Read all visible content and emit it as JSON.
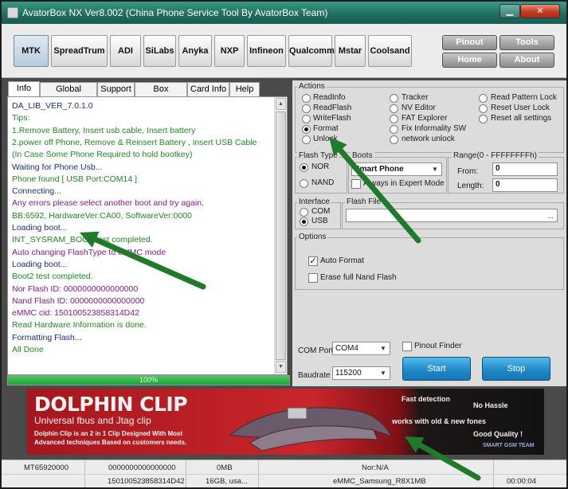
{
  "window": {
    "title": "AvatorBox NX Ver8.002 (China Phone Service Tool By AvatorBox Team)",
    "minimize_glyph": "▁",
    "close_glyph": "✕"
  },
  "platforms": [
    "MTK",
    "SpreadTrum",
    "ADI",
    "SiLabs",
    "Anyka",
    "NXP",
    "Infineon",
    "Qualcomm",
    "Mstar",
    "Coolsand"
  ],
  "nav": {
    "pinout": "Pinout",
    "tools": "Tools",
    "home": "Home",
    "about": "About"
  },
  "tabs": [
    "Info",
    "Global Settings",
    "Support",
    "Box Manager",
    "Card Info",
    "Help"
  ],
  "log": [
    {
      "text": "DA_LIB_VER_7.0.1.0",
      "color": "navy"
    },
    {
      "text": "Tips:",
      "color": "green"
    },
    {
      "text": "1.Remove Battery, Insert usb cable, Insert battery",
      "color": "green"
    },
    {
      "text": "2.power off Phone, Remove & Reinsert Battery , insert USB Cable",
      "color": "green"
    },
    {
      "text": "(In Case Some Phone Required to hold bootkey)",
      "color": "green"
    },
    {
      "text": "Waiting for Phone Usb...",
      "color": "navy"
    },
    {
      "text": "Phone found [ USB Port:COM14 ]",
      "color": "green"
    },
    {
      "text": "Connecting...",
      "color": "navy"
    },
    {
      "text": "Any errors please select another boot and try again.",
      "color": "purple"
    },
    {
      "text": "BB:6592,    HardwareVer:CA00,    SoftwareVer:0000",
      "color": "green"
    },
    {
      "text": "Loading boot...",
      "color": "navy"
    },
    {
      "text": "INT_SYSRAM_BOOT test completed.",
      "color": "green"
    },
    {
      "text": "Auto changing FlashType to eMMC mode",
      "color": "purple"
    },
    {
      "text": "Loading boot...",
      "color": "navy"
    },
    {
      "text": "Boot2 test completed.",
      "color": "green"
    },
    {
      "text": "Nor Flash ID: 0000000000000000",
      "color": "purple"
    },
    {
      "text": "Nand Flash ID: 0000000000000000",
      "color": "purple"
    },
    {
      "text": "eMMC cid: 150100523858314D42",
      "color": "purple"
    },
    {
      "text": "Read Hardware Information is done.",
      "color": "green"
    },
    {
      "text": "Formatting Flash...",
      "color": "navy"
    },
    {
      "text": "All Done",
      "color": "green"
    }
  ],
  "progress": {
    "percent": 100,
    "label": "100%"
  },
  "actions": {
    "legend": "Actions",
    "items": [
      {
        "label": "ReadInfo",
        "selected": false
      },
      {
        "label": "ReadFlash",
        "selected": false
      },
      {
        "label": "WriteFlash",
        "selected": false
      },
      {
        "label": "Format",
        "selected": true
      },
      {
        "label": "Unlock",
        "selected": false
      },
      {
        "label": "Tracker",
        "selected": false
      },
      {
        "label": "NV Editor",
        "selected": false
      },
      {
        "label": "FAT Explorer",
        "selected": false
      },
      {
        "label": "Fix Informality SW",
        "selected": false
      },
      {
        "label": "network unlock",
        "selected": false
      },
      {
        "label": "Read Pattern Lock",
        "selected": false
      },
      {
        "label": "Reset User Lock",
        "selected": false
      },
      {
        "label": "Reset all settings",
        "selected": false
      }
    ]
  },
  "flash_type": {
    "legend": "Flash Type",
    "nor": "NOR",
    "nand": "NAND",
    "selected": "NOR"
  },
  "boots": {
    "legend": "Boots",
    "value": "Smart Phone",
    "always_expert": "Always in Expert Mode"
  },
  "range": {
    "legend": "Range(0 - FFFFFFFFh)",
    "from_label": "From:",
    "from_value": "0",
    "length_label": "Length:",
    "length_value": "0"
  },
  "interface": {
    "legend": "Interface",
    "com": "COM",
    "usb": "USB",
    "selected": "USB"
  },
  "flash_file": {
    "legend": "Flash File",
    "browse": "..."
  },
  "options": {
    "legend": "Options",
    "auto_format": "Auto Format",
    "auto_format_checked": true,
    "erase_nand": "Erase full Nand Flash",
    "erase_nand_checked": false
  },
  "port": {
    "com_label": "COM Port",
    "com_value": "COM4",
    "baud_label": "Baudrate",
    "baud_value": "115200",
    "pinout_finder": "Pinout Finder"
  },
  "buttons": {
    "start": "Start",
    "stop": "Stop"
  },
  "banner": {
    "title": "DOLPHIN CLIP",
    "subtitle": "Universal fbus and Jtag clip",
    "desc": "Dolphin Clip is an 2 in 1 Clip Designed With Most Advanced techniques Based on customers needs.",
    "fast": "Fast detection",
    "hassle": "No Hassle",
    "works": "works with old & new fones",
    "quality": "Good Quality !",
    "team": "SMART GSM TEAM"
  },
  "status": {
    "row1": [
      "MT65920000",
      "0000000000000000",
      "0MB",
      "Nor:N/A"
    ],
    "row2": [
      "150100523858314D42",
      "16GB, usa...",
      "eMMC_Samsung_R8X1MB",
      "00:00:04"
    ]
  },
  "colors": {
    "arrow": "#1f7a2a",
    "titlebar": "#1f6b5e",
    "log_navy": "#1c2c8c",
    "log_green": "#1f8a1f",
    "log_purple": "#8a1a8a"
  }
}
